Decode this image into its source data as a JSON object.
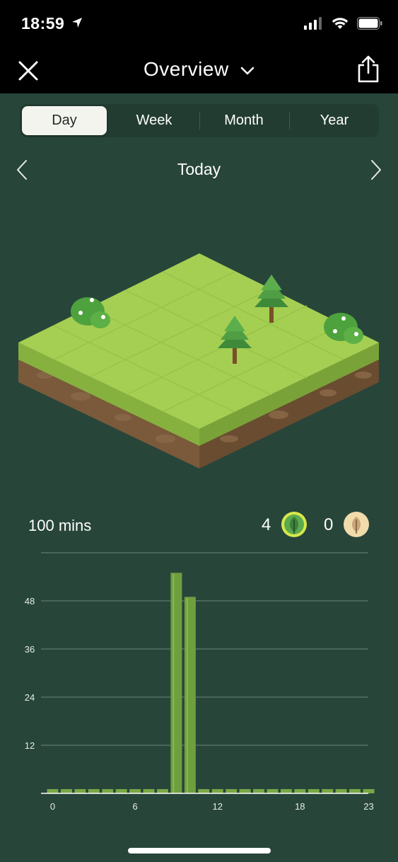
{
  "status": {
    "time": "18:59"
  },
  "nav": {
    "title": "Overview"
  },
  "tabs": [
    {
      "label": "Day",
      "active": true
    },
    {
      "label": "Week",
      "active": false
    },
    {
      "label": "Month",
      "active": false
    },
    {
      "label": "Year",
      "active": false
    }
  ],
  "date_label": "Today",
  "summary": {
    "minutes": "100 mins",
    "healthy_trees": "4",
    "dead_trees": "0"
  },
  "colors": {
    "background": "#28453a",
    "bar": "#7aab44",
    "grass": "#a5cf52",
    "dirt": "#7a5a3b"
  },
  "icons": [
    "close-icon",
    "chevron-down-icon",
    "share-icon",
    "chevron-left-icon",
    "chevron-right-icon",
    "leaf-icon",
    "withered-leaf-icon"
  ],
  "chart_data": {
    "type": "bar",
    "x": [
      0,
      1,
      2,
      3,
      4,
      5,
      6,
      7,
      8,
      9,
      10,
      11,
      12,
      13,
      14,
      15,
      16,
      17,
      18,
      19,
      20,
      21,
      22,
      23
    ],
    "values": [
      0,
      0,
      0,
      0,
      0,
      0,
      0,
      0,
      0,
      55,
      49,
      0,
      0,
      0,
      0,
      0,
      0,
      0,
      0,
      0,
      0,
      0,
      0,
      0
    ],
    "xticks": [
      "0",
      "6",
      "12",
      "18",
      "23"
    ],
    "yticks": [
      "12",
      "24",
      "36",
      "48"
    ],
    "ylim": [
      0,
      60
    ],
    "grid": true,
    "xlabel": "",
    "ylabel": ""
  }
}
